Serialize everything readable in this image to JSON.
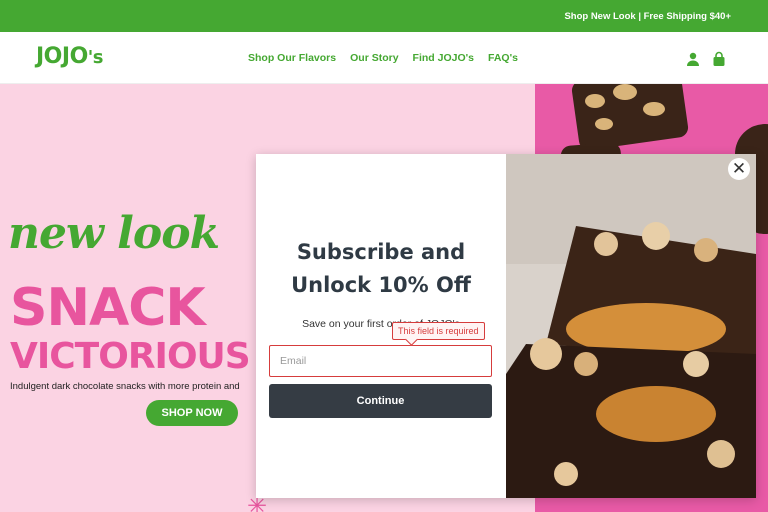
{
  "announcement": {
    "text": "Shop New Look | Free Shipping $40+"
  },
  "header": {
    "logo": {
      "main": "JOJO",
      "suffix": "'s"
    },
    "nav": [
      {
        "label": "Shop Our Flavors"
      },
      {
        "label": "Our Story"
      },
      {
        "label": "Find JOJO's"
      },
      {
        "label": "FAQ's"
      }
    ],
    "icons": [
      "account-icon",
      "cart-icon"
    ]
  },
  "hero": {
    "headline_1": "new look",
    "headline_2": "SNACK",
    "headline_3": "VICTORIOUS",
    "subtext": "Indulgent dark chocolate snacks with more protein and",
    "cta_label": "SHOP NOW"
  },
  "modal": {
    "title_line_1": "Subscribe and",
    "title_line_2": "Unlock 10% Off",
    "subtitle": "Save on your first order of JOJO's",
    "validation_message": "This field is required",
    "email_placeholder": "Email",
    "email_value": "",
    "submit_label": "Continue",
    "close_icon": "close-icon"
  },
  "colors": {
    "brand_green": "#45a832",
    "brand_pink": "#e8559e",
    "hero_bg": "#fbd3e3",
    "button_dark": "#353c44",
    "error_red": "#d63c3c"
  }
}
